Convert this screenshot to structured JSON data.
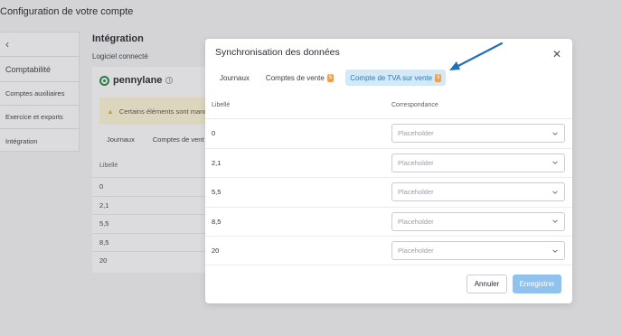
{
  "page": {
    "title": "Configuration de votre compte"
  },
  "sidebar": {
    "heading": "Comptabilité",
    "items": [
      {
        "label": "Comptes auxiliaires"
      },
      {
        "label": "Exercice et exports"
      },
      {
        "label": "Intégration"
      }
    ]
  },
  "background": {
    "title": "Intégration",
    "subtitle": "Logiciel connecté",
    "logo_text": "pennylane",
    "alert_text": "Certains éléments sont manq",
    "tabs": [
      "Journaux",
      "Comptes de vent"
    ],
    "column_header": "Libellé",
    "rows": [
      "0",
      "2,1",
      "5,5",
      "8,5",
      "20"
    ]
  },
  "modal": {
    "title": "Synchronisation des données",
    "tabs": [
      {
        "label": "Journaux"
      },
      {
        "label": "Comptes de vente",
        "badge": "5"
      },
      {
        "label": "Compte de TVA sur vente",
        "badge": "5",
        "active": true
      }
    ],
    "columns": {
      "label": "Libellé",
      "match": "Correspondance"
    },
    "rows": [
      {
        "label": "0",
        "placeholder": "Placeholder"
      },
      {
        "label": "2,1",
        "placeholder": "Placeholder"
      },
      {
        "label": "5,5",
        "placeholder": "Placeholder"
      },
      {
        "label": "8,5",
        "placeholder": "Placeholder"
      },
      {
        "label": "20",
        "placeholder": "Placeholder"
      }
    ],
    "buttons": {
      "cancel": "Annuler",
      "save": "Enregistrer"
    }
  },
  "colors": {
    "accent": "#2f7bb5",
    "active_tab_bg": "#d4e9f7",
    "badge": "#f2a04b",
    "save_button": "#8fc3ee",
    "arrow": "#1f6fbf"
  }
}
